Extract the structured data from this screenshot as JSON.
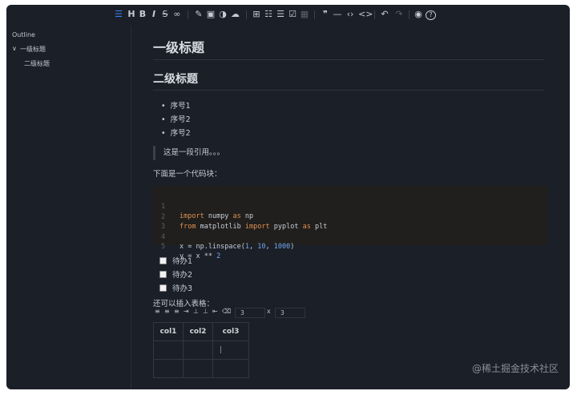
{
  "toolbar": {
    "items": [
      {
        "name": "align-icon",
        "glyph": "☰",
        "active": true
      },
      {
        "name": "heading-icon",
        "glyph": "H"
      },
      {
        "name": "bold-icon",
        "glyph": "B"
      },
      {
        "name": "italic-icon",
        "glyph": "I"
      },
      {
        "name": "strikethrough-icon",
        "glyph": "S"
      },
      {
        "name": "link-icon",
        "glyph": "∞"
      },
      {
        "name": "edit-icon",
        "glyph": "✎"
      },
      {
        "name": "image-icon",
        "glyph": "▣"
      },
      {
        "name": "sticker-icon",
        "glyph": "◑"
      },
      {
        "name": "upload-cloud-icon",
        "glyph": "☁"
      },
      {
        "name": "add-block-icon",
        "glyph": "⊞"
      },
      {
        "name": "bullet-list-icon",
        "glyph": "☷"
      },
      {
        "name": "ordered-list-icon",
        "glyph": "☰"
      },
      {
        "name": "task-list-icon",
        "glyph": "☑"
      },
      {
        "name": "table-icon",
        "glyph": "▦",
        "dim": true
      },
      {
        "name": "quote-icon",
        "glyph": "❞"
      },
      {
        "name": "horizontal-rule-icon",
        "glyph": "—"
      },
      {
        "name": "inline-code-icon",
        "glyph": "‹›"
      },
      {
        "name": "code-block-icon",
        "glyph": "<>"
      },
      {
        "name": "undo-icon",
        "glyph": "↶"
      },
      {
        "name": "redo-icon",
        "glyph": "↷",
        "dim": true
      },
      {
        "name": "preview-icon",
        "glyph": "◉"
      },
      {
        "name": "help-icon",
        "glyph": "?"
      }
    ]
  },
  "outline": {
    "title": "Outline",
    "chevron": "∨",
    "items": [
      "一级标题",
      "二级标题"
    ]
  },
  "content": {
    "h1": "一级标题",
    "h2": "二级标题",
    "list": [
      "序号1",
      "序号2",
      "序号2"
    ],
    "quote": "这是一段引用。。。",
    "code_intro": "下面是一个代码块：",
    "code_lines": [
      "1",
      "2",
      "3",
      "4",
      "5"
    ],
    "tasks": [
      "待办1",
      "待办2",
      "待办3"
    ],
    "table_intro": "还可以插入表格："
  },
  "table_toolbar": {
    "icons": [
      "≡",
      "≡",
      "≡",
      "⇥",
      "⊥",
      "⊥",
      "⇤",
      "⌫"
    ],
    "rows": "3",
    "x": "x",
    "cols": "3"
  },
  "table": {
    "headers": [
      "col1",
      "col2",
      "col3"
    ]
  },
  "watermark": "@稀土掘金技术社区"
}
